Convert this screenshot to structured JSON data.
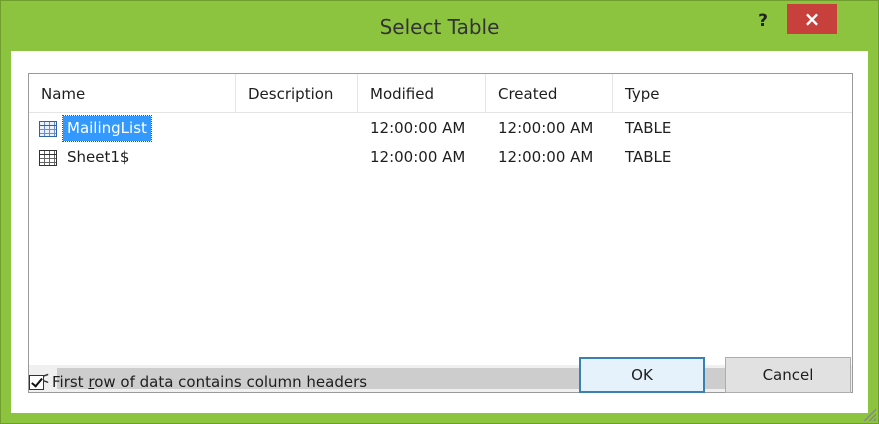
{
  "window": {
    "title": "Select Table",
    "help_label": "?",
    "close_label": "×",
    "frame_color": "#8cc43f"
  },
  "list": {
    "columns": [
      "Name",
      "Description",
      "Modified",
      "Created",
      "Type"
    ],
    "rows": [
      {
        "name": "MailingList",
        "description": "",
        "modified": "12:00:00 AM",
        "created": "12:00:00 AM",
        "type": "TABLE",
        "selected": true
      },
      {
        "name": "Sheet1$",
        "description": "",
        "modified": "12:00:00 AM",
        "created": "12:00:00 AM",
        "type": "TABLE",
        "selected": false
      }
    ],
    "icons": {
      "table": "table-icon",
      "scroll_left": "chevron-left-icon",
      "scroll_right": "chevron-right-icon"
    },
    "scroll_left_label": "<",
    "scroll_right_label": ">"
  },
  "options": {
    "first_row_headers": {
      "prefix": "First ",
      "accesskey": "r",
      "suffix": "ow of data contains column headers",
      "checked": true
    }
  },
  "buttons": {
    "ok_label": "OK",
    "cancel_label": "Cancel"
  },
  "colors": {
    "selection": "#3399ff",
    "close_button": "#c7403c"
  }
}
